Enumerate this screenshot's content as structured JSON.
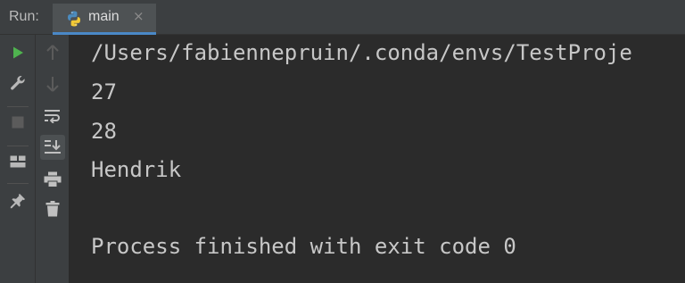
{
  "run_panel": {
    "label": "Run:",
    "tab": {
      "label": "main",
      "icon": "python-icon",
      "close_glyph": "×"
    }
  },
  "toolbar_primary": [
    {
      "name": "rerun-icon",
      "color": "#4fb34f"
    },
    {
      "name": "wrench-icon",
      "color": "#b8b8b8"
    },
    {
      "name": "stop-icon",
      "color": "#5b5b5b"
    },
    {
      "name": "layout-icon",
      "color": "#b8b8b8"
    },
    {
      "name": "pin-icon",
      "color": "#b8b8b8"
    }
  ],
  "toolbar_secondary": [
    {
      "name": "arrow-up-icon",
      "enabled": false
    },
    {
      "name": "arrow-down-icon",
      "enabled": false
    },
    {
      "name": "soft-wrap-icon",
      "enabled": true
    },
    {
      "name": "scroll-to-end-icon",
      "enabled": true,
      "active": true
    },
    {
      "name": "print-icon",
      "enabled": true
    },
    {
      "name": "trash-icon",
      "enabled": true
    }
  ],
  "console": {
    "lines": [
      "/Users/fabiennepruin/.conda/envs/TestProje",
      "27",
      "28",
      "Hendrik",
      "",
      "Process finished with exit code 0"
    ]
  },
  "colors": {
    "background": "#2b2b2b",
    "toolbar": "#3c3f41",
    "text": "#c7c7c7",
    "tab_accent": "#4a88c7",
    "run_green": "#4fb34f"
  }
}
